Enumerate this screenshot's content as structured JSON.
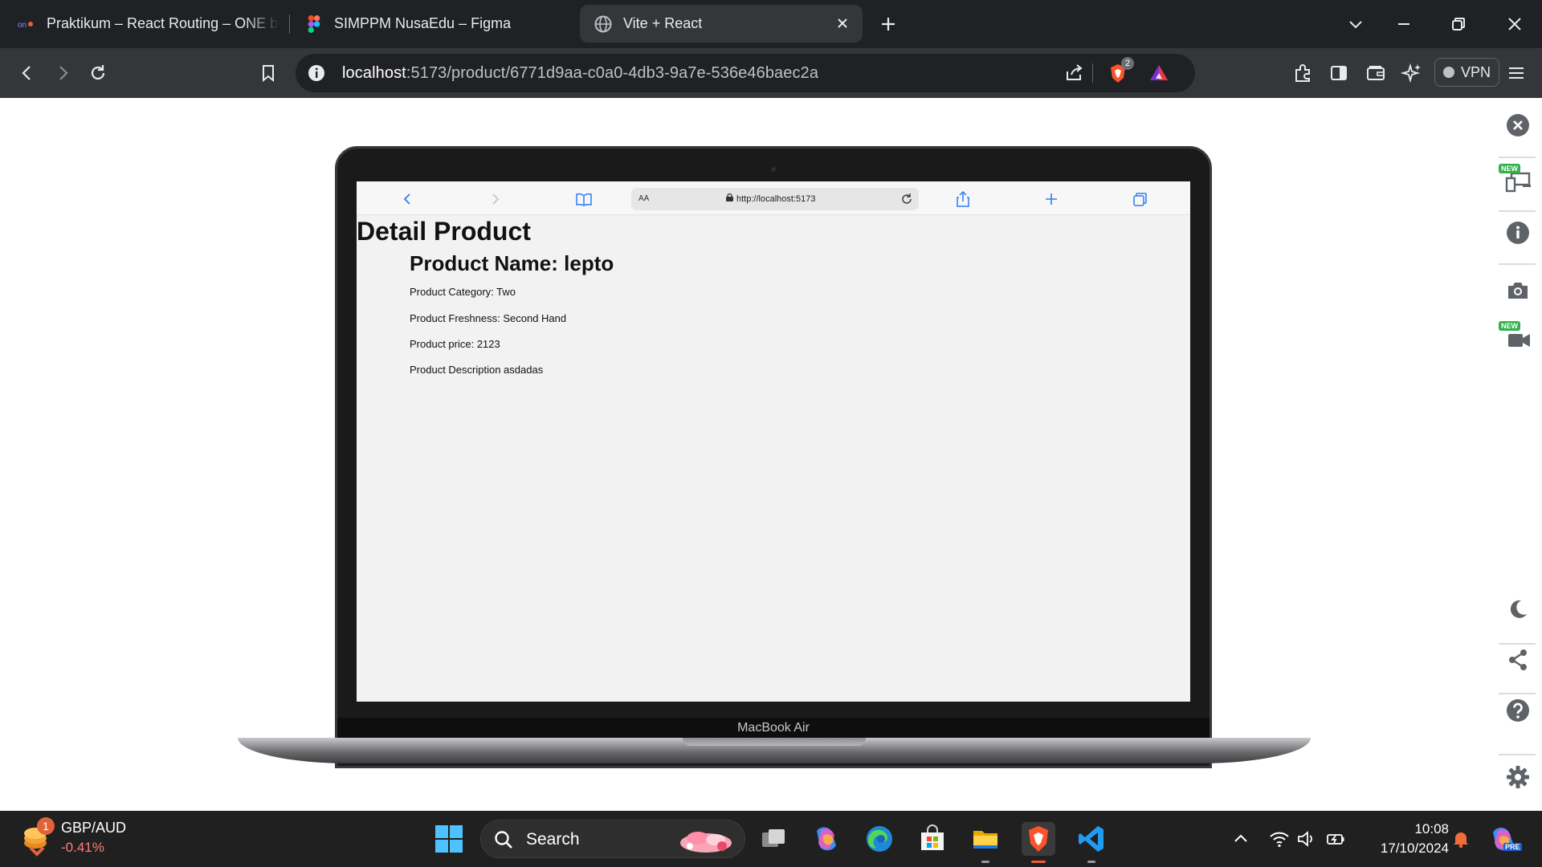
{
  "browser": {
    "tabs": [
      {
        "label": "Praktikum – React Routing – ONE by"
      },
      {
        "label": "SIMPPM NusaEdu – Figma"
      },
      {
        "label": "Vite + React"
      }
    ],
    "url_host": "localhost",
    "url_path": ":5173/product/6771d9aa-c0a0-4db3-9a7e-536e46baec2a",
    "shields_count": "2",
    "vpn_label": "VPN",
    "colors": {
      "brave_orange": "#fb542b",
      "tab_active": "#35363a"
    }
  },
  "sidepanel": {
    "new_badge": "NEW"
  },
  "device": {
    "label": "MacBook Air"
  },
  "safari": {
    "aa": "AA",
    "url": "http://localhost:5173"
  },
  "app": {
    "title": "Detail Product",
    "product_name": "Product Name: lepto",
    "category": "Product Category: Two",
    "freshness": "Product Freshness: Second Hand",
    "price": "Product price: 2123",
    "description": "Product Description asdadas"
  },
  "taskbar": {
    "widget_badge": "1",
    "pair": "GBP/AUD",
    "change": "-0.41%",
    "search_label": "Search",
    "time": "10:08",
    "date": "17/10/2024",
    "copilot_badge": "PRE"
  }
}
